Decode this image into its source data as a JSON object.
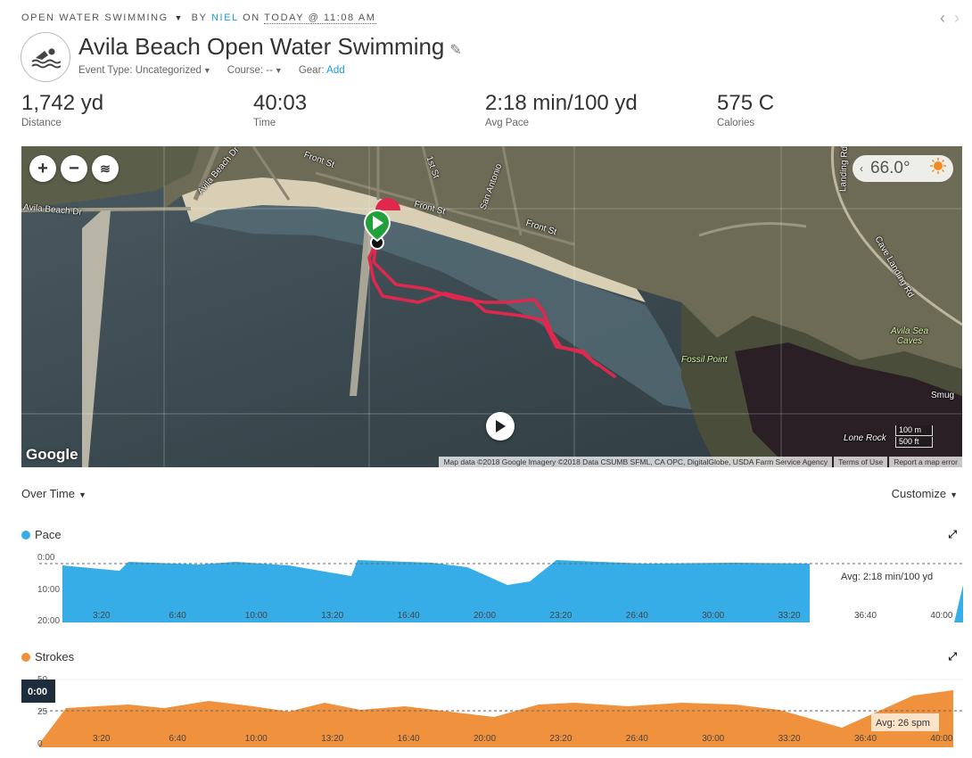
{
  "header": {
    "activity_type": "OPEN WATER SWIMMING",
    "by": "BY",
    "owner": "NIEL",
    "on": "ON",
    "datetime": "TODAY @ 11:08 AM",
    "title": "Avila Beach Open Water Swimming",
    "event_type": "Event Type: Uncategorized",
    "course": "Course: --",
    "gear_label": "Gear:",
    "gear_link": "Add"
  },
  "stats": [
    {
      "value": "1,742 yd",
      "label": "Distance"
    },
    {
      "value": "40:03",
      "label": "Time"
    },
    {
      "value": "2:18 min/100 yd",
      "label": "Avg Pace"
    },
    {
      "value": "575 C",
      "label": "Calories"
    }
  ],
  "map": {
    "temperature": "66.0°",
    "google_logo": "Google",
    "scale_m": "100 m",
    "scale_ft": "500 ft",
    "attribution": "Map data ©2018 Google Imagery ©2018 Data CSUMB SFML, CA OPC, DigitalGlobe, USDA Farm Service Agency",
    "terms": "Terms of Use",
    "report": "Report a map error",
    "labels": {
      "front_st_1": "Front St",
      "front_st_2": "Front St",
      "front_st_3": "Front St",
      "avila_beach_dr_1": "Avila Beach Dr",
      "avila_beach_dr_2": "Avila Beach Dr",
      "first_st": "1st St",
      "san_antonio": "San Antonio",
      "fossil_point": "Fossil Point",
      "avila_sea_caves": "Avila Sea Caves",
      "cave_landing": "Cave Landing Rd",
      "landing_rd": "Landing Rd",
      "lone_rock": "Lone Rock",
      "smuggler": "Smug"
    },
    "route_color": "#e0284f"
  },
  "charts_header": {
    "mode": "Over Time",
    "customize": "Customize"
  },
  "pace_chart": {
    "label": "Pace",
    "color": "#36ade7",
    "avg_label": "Avg: 2:18 min/100 yd",
    "y_ticks": [
      "0:00",
      "10:00",
      "20:00"
    ],
    "x_ticks": [
      "3:20",
      "6:40",
      "10:00",
      "13:20",
      "16:40",
      "20:00",
      "23:20",
      "26:40",
      "30:00",
      "33:20",
      "36:40",
      "40:00"
    ]
  },
  "strokes_chart": {
    "label": "Strokes",
    "color": "#f0913e",
    "avg_label": "Avg: 26 spm",
    "cursor_label": "0:00",
    "y_ticks": [
      "50",
      "25",
      "0"
    ],
    "x_ticks": [
      "3:20",
      "6:40",
      "10:00",
      "13:20",
      "16:40",
      "20:00",
      "23:20",
      "26:40",
      "30:00",
      "33:20",
      "36:40",
      "40:00"
    ]
  }
}
